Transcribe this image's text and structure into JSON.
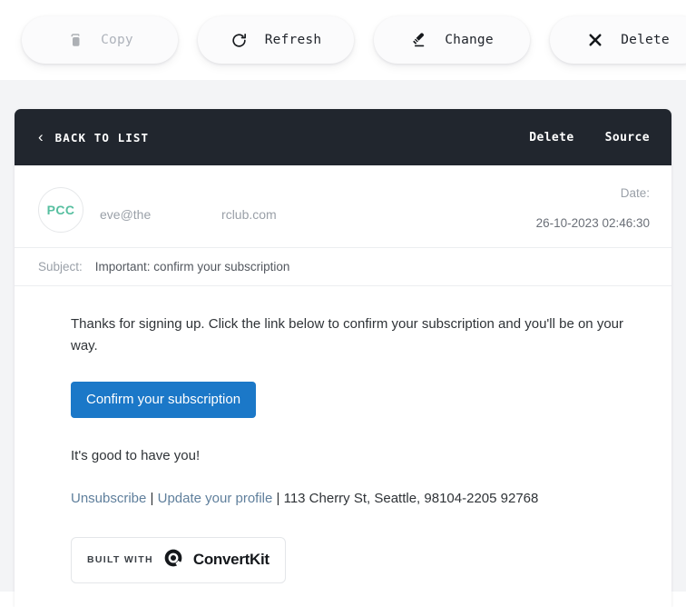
{
  "toolbar": {
    "buttons": [
      {
        "label": "Copy",
        "icon": "copy-icon",
        "disabled": true
      },
      {
        "label": "Refresh",
        "icon": "refresh-icon",
        "disabled": false
      },
      {
        "label": "Change",
        "icon": "pen-icon",
        "disabled": false
      },
      {
        "label": "Delete",
        "icon": "close-x-icon",
        "disabled": false
      }
    ]
  },
  "mail_header": {
    "back_label": "BACK TO LIST",
    "back_icon": "chevron-left-icon",
    "delete_label": "Delete",
    "source_label": "Source",
    "background": "#21262e"
  },
  "message": {
    "avatar_initials": "PCC",
    "avatar_color": "#57bfa0",
    "from_address": "eve@the                    rclub.com",
    "date_label": "Date:",
    "date_value": "26-10-2023 02:46:30",
    "subject_label": "Subject:",
    "subject_value": "Important: confirm your subscription"
  },
  "body": {
    "paragraph": "Thanks for signing up. Click the link below to confirm your subscription and you'll be on your way.",
    "cta_label": "Confirm your subscription",
    "cta_color": "#1b78c8",
    "closing": "It's good to have you!",
    "unsubscribe_label": "Unsubscribe",
    "update_profile_label": "Update your profile",
    "separator": " | ",
    "address": "113 Cherry St, Seattle, 98104-2205 92768",
    "badge_built_with": "BUILT WITH",
    "badge_brand": "ConvertKit"
  }
}
